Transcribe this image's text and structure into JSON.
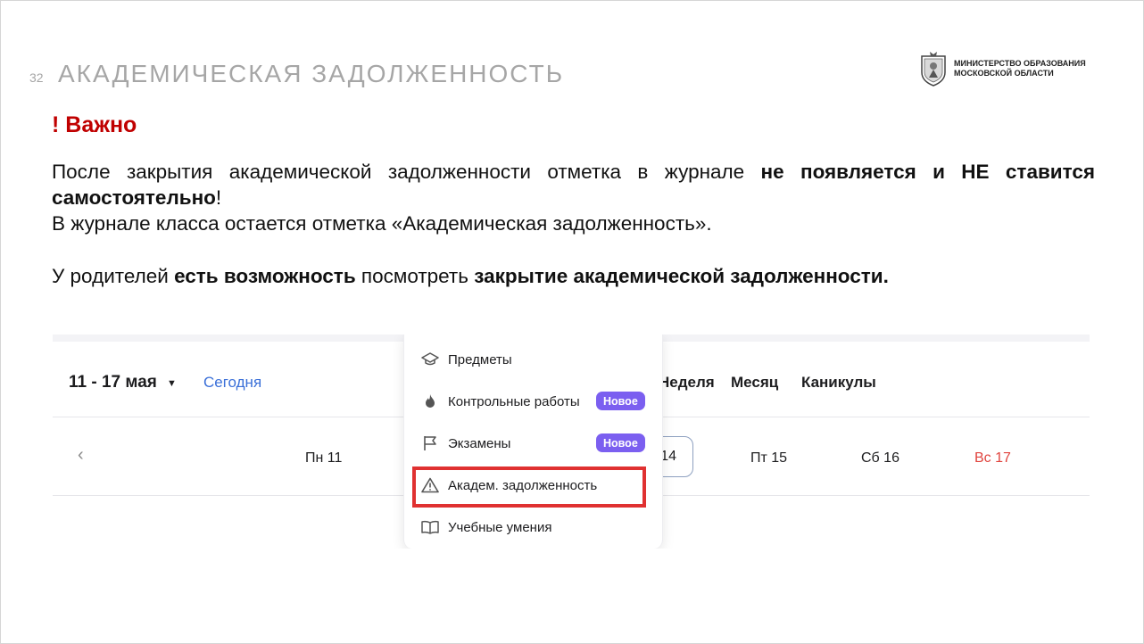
{
  "slide": {
    "number": "32",
    "title": "АКАДЕМИЧЕСКАЯ ЗАДОЛЖЕННОСТЬ",
    "org_line1": "МИНИСТЕРСТВО ОБРАЗОВАНИЯ",
    "org_line2": "МОСКОВСКОЙ ОБЛАСТИ",
    "important": "! Важно",
    "p1_a": "После закрытия академической задолженности отметка в журнале ",
    "p1_b": "не появляется и НЕ ставится самостоятельно",
    "p1_c": "!",
    "p1_line2": "В журнале класса остается отметка «Академическая задолженность».",
    "p2_a": "У родителей ",
    "p2_b": "есть возможность",
    "p2_c": " посмотреть ",
    "p2_d": "закрытие академической задолженности."
  },
  "screenshot": {
    "date_range": "11 - 17 мая",
    "today_link": "Сегодня",
    "view_tabs": [
      "Неделя",
      "Месяц",
      "Каникулы"
    ],
    "days": [
      "Пн  11",
      "14",
      "Пт  15",
      "Сб  16",
      "Вс  17"
    ],
    "menu": {
      "items": [
        "Предметы",
        "Контрольные работы",
        "Экзамены",
        "Академ. задолженность",
        "Учебные умения"
      ],
      "badge": "Новое"
    }
  },
  "colors": {
    "accent_red": "#c00000",
    "title_gray": "#a6a6a6",
    "badge_purple": "#7b5ff0",
    "highlight_red": "#e03131",
    "link_blue": "#3a6fd8",
    "sunday_red": "#e0443e"
  },
  "icons": [
    "emblem-icon",
    "graduation-cap-icon",
    "fire-icon",
    "flag-icon",
    "warning-triangle-icon",
    "book-icon",
    "caret-down-icon",
    "chevron-left-icon"
  ]
}
